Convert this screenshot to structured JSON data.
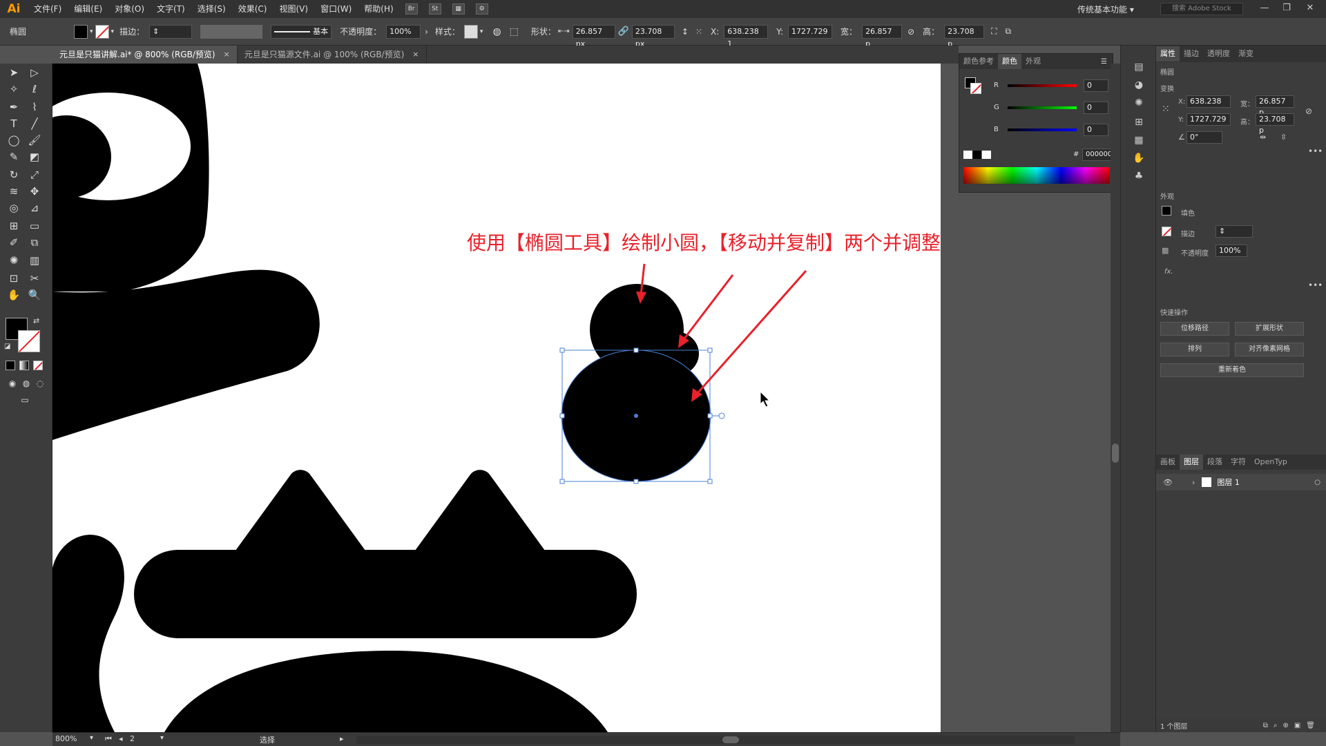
{
  "app": {
    "logo": "Ai"
  },
  "menubar": {
    "items": [
      "文件(F)",
      "编辑(E)",
      "对象(O)",
      "文字(T)",
      "选择(S)",
      "效果(C)",
      "视图(V)",
      "窗口(W)",
      "帮助(H)"
    ],
    "workspace": "传统基本功能",
    "search_placeholder": "搜索 Adobe Stock"
  },
  "controlbar": {
    "object_type": "椭圆",
    "stroke_label": "描边：",
    "stroke_style": "基本",
    "opacity_label": "不透明度：",
    "opacity_value": "100%",
    "style_label": "样式：",
    "shape_label": "形状：",
    "shape_w": "26.857 px",
    "shape_h": "23.708 px",
    "x_label": "X:",
    "x_value": "638.238 1",
    "y_label": "Y:",
    "y_value": "1727.729",
    "w_label": "宽：",
    "w_value": "26.857 p",
    "h_label": "高：",
    "h_value": "23.708 p"
  },
  "tabs": [
    {
      "label": "元旦是只猫讲解.ai* @ 800% (RGB/预览)",
      "close": "×"
    },
    {
      "label": "元旦是只猫源文件.ai @ 100% (RGB/预览)",
      "close": "×"
    }
  ],
  "color_panel": {
    "tabs": [
      "颜色参考",
      "颜色",
      "外观"
    ],
    "r_label": "R",
    "r_value": "0",
    "g_label": "G",
    "g_value": "0",
    "b_label": "B",
    "b_value": "0",
    "hex_label": "#",
    "hex_value": "000000"
  },
  "right_panel": {
    "tabs": [
      "属性",
      "描边",
      "透明度",
      "渐变"
    ],
    "section_object": "椭圆",
    "section_transform": "变换",
    "x_label": "X:",
    "x_value": "638.238",
    "y_label": "Y:",
    "y_value": "1727.729",
    "w_label": "宽：",
    "w_value": "26.857 p",
    "h_label": "高：",
    "h_value": "23.708 p",
    "angle_value": "0°",
    "section_appearance": "外观",
    "fill_label": "填色",
    "stroke_label": "描边",
    "opacity_label": "不透明度",
    "opacity_value": "100%",
    "fx_label": "fx.",
    "section_quick": "快速操作",
    "btn_offset": "位移路径",
    "btn_expand": "扩展形状",
    "btn_arrange": "排列",
    "btn_align_pixel": "对齐像素网格",
    "btn_recolor": "重新着色",
    "layer_tabs": [
      "画板",
      "图层",
      "段落",
      "字符",
      "OpenTyp"
    ],
    "layer_name": "图层 1",
    "layer_count": "1 个图层"
  },
  "annotation": "使用【椭圆工具】绘制小圆，【移动并复制】两个并调整",
  "statusbar": {
    "zoom": "800%",
    "page": "2",
    "mode": "选择"
  },
  "colors": {
    "annotation_red": "#e8212a",
    "selection_blue": "#4a7fd4",
    "app_orange": "#ff9a00"
  }
}
